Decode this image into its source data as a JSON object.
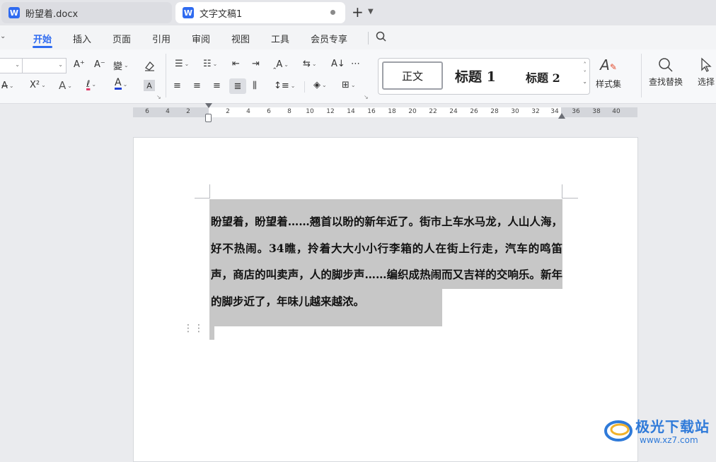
{
  "tabs": [
    {
      "title": "盼望着.docx",
      "icon": "word-doc-icon",
      "active": false
    },
    {
      "title": "文字文稿1",
      "icon": "word-doc-icon",
      "active": true
    }
  ],
  "tab_controls": {
    "new_tab": "+",
    "menu": "⌄"
  },
  "menu": [
    "开始",
    "插入",
    "页面",
    "引用",
    "审阅",
    "视图",
    "工具",
    "会员专享"
  ],
  "active_menu": "开始",
  "ribbon": {
    "font_size_inc": "A⁺",
    "font_size_dec": "A⁻",
    "superscript": "X²",
    "styles": {
      "normal": "正文",
      "heading1": "标题 1",
      "heading2": "标题 2"
    },
    "style_set_label": "样式集",
    "find_replace_label": "查找替换",
    "select_label": "选择"
  },
  "ruler": {
    "labels": [
      "6",
      "4",
      "2",
      "2",
      "4",
      "6",
      "8",
      "10",
      "12",
      "14",
      "16",
      "18",
      "20",
      "22",
      "24",
      "26",
      "28",
      "30",
      "32",
      "34",
      "36",
      "38",
      "40"
    ]
  },
  "document": {
    "text": "盼望着，盼望着……翘首以盼的新年近了。街市上车水马龙，人山人海，好不热闹。34瞧，拎着大大小小行李箱的人在街上行走，汽车的鸣笛声，商店的叫卖声，人的脚步声……编织成热闹而又吉祥的交响乐。新年的脚步近了，年味儿越来越浓。"
  },
  "watermark": {
    "name": "极光下载站",
    "url": "www.xz7.com"
  },
  "colors": {
    "accent": "#2f6bf0",
    "selection": "#c7c7c7",
    "font_color_bar": "#1f3fd6"
  }
}
